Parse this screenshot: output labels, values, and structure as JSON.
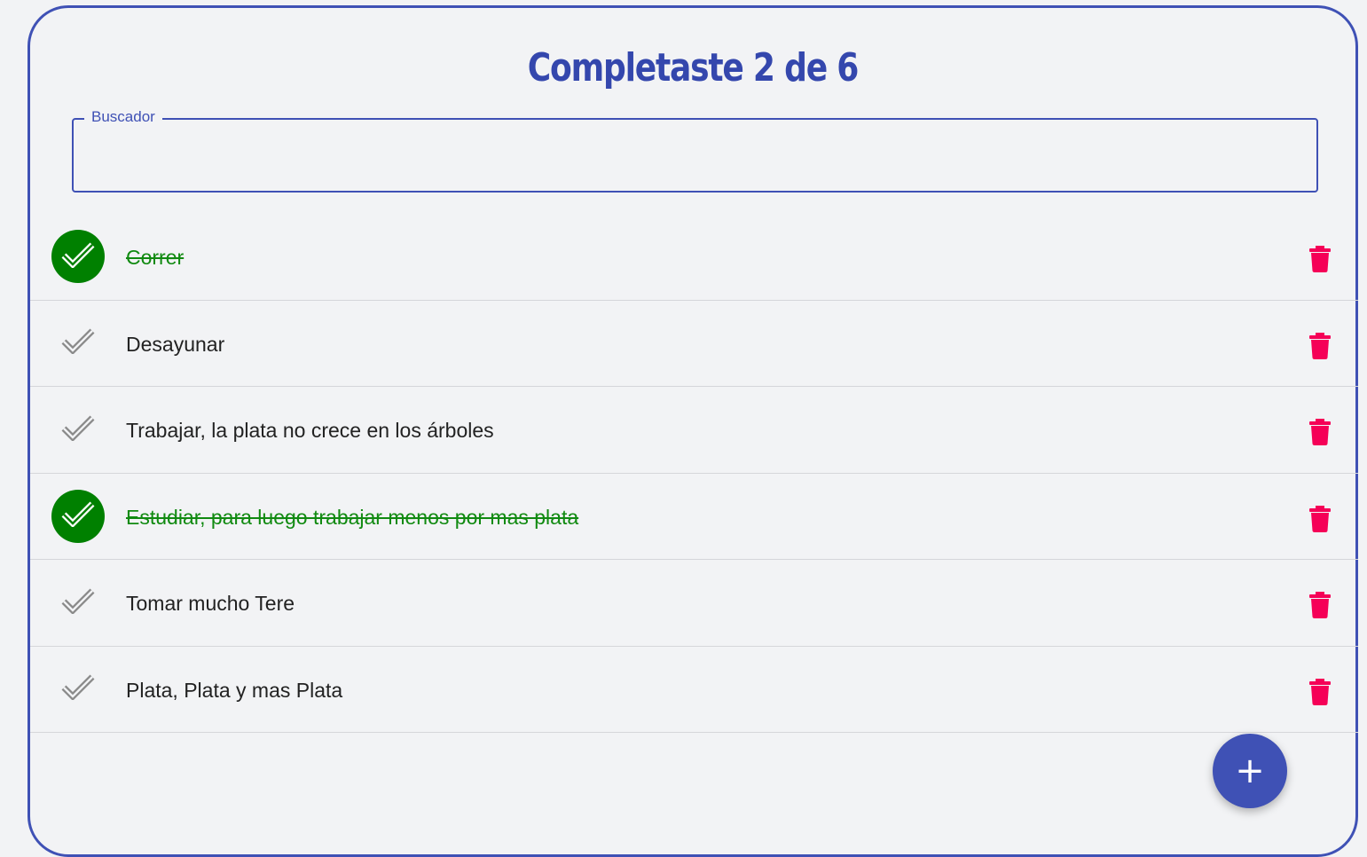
{
  "header": {
    "title": "Completaste 2 de 6"
  },
  "search": {
    "label": "Buscador",
    "value": "",
    "placeholder": ""
  },
  "todos": [
    {
      "text": "Correr",
      "completed": true
    },
    {
      "text": "Desayunar",
      "completed": false
    },
    {
      "text": "Trabajar, la plata no crece en los árboles",
      "completed": false
    },
    {
      "text": "Estudiar, para luego trabajar menos por mas plata",
      "completed": true
    },
    {
      "text": "Tomar mucho Tere",
      "completed": false
    },
    {
      "text": "Plata, Plata y mas Plata",
      "completed": false
    }
  ],
  "fab": {
    "label": "+"
  },
  "colors": {
    "accent": "#3f51b5",
    "done": "#008000",
    "delete": "#f50057",
    "pending_check": "#8a8a8a"
  },
  "icons": {
    "check": "check-icon",
    "delete": "trash-icon",
    "add": "plus-icon"
  }
}
